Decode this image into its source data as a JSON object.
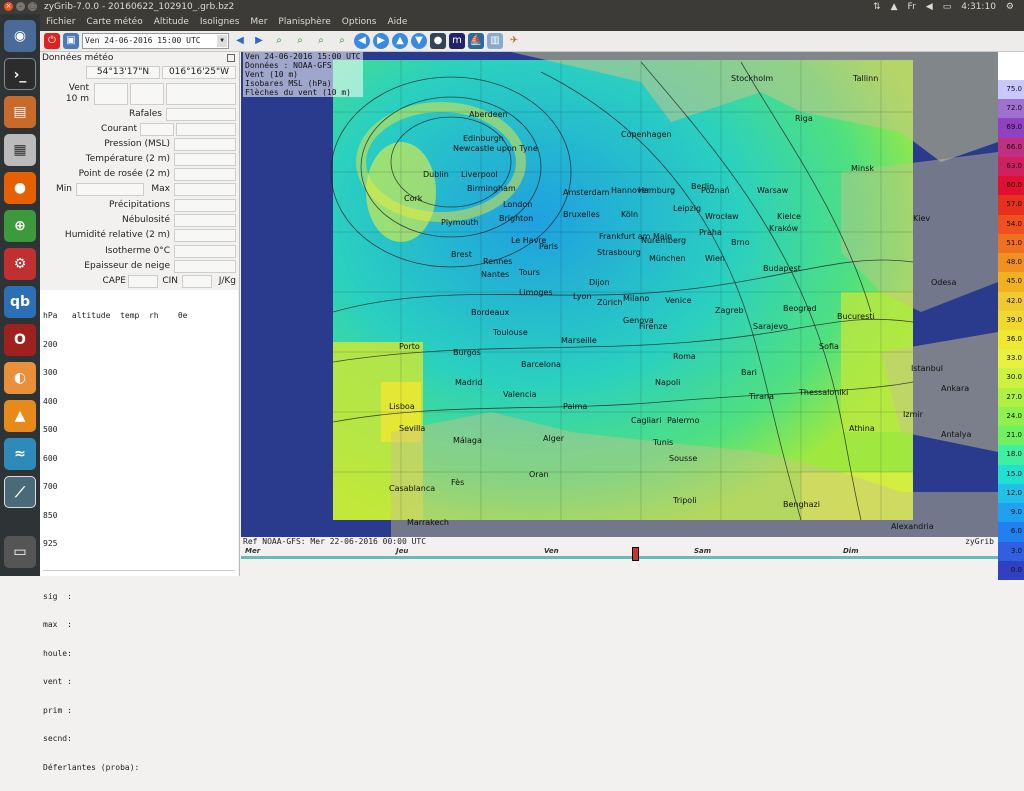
{
  "window": {
    "title": "zyGrib-7.0.0 - 20160622_102910_.grb.bz2"
  },
  "tray": {
    "indicator": "⇅",
    "wifi": "▲",
    "keyboard": "Fr",
    "volume": "◀",
    "battery": "▭",
    "clock": "4:31:10",
    "power": "⚙"
  },
  "menu": [
    "Fichier",
    "Carte météo",
    "Altitude",
    "Isolignes",
    "Mer",
    "Planisphère",
    "Options",
    "Aide"
  ],
  "toolbar": {
    "date_value": "Ven 24-06-2016 15:00 UTC"
  },
  "panel": {
    "title": "Données météo",
    "lat": "54°13'17\"N",
    "lon": "016°16'25\"W",
    "vent": "Vent",
    "vent_alt": "10 m",
    "rafales": "Rafales",
    "courant": "Courant",
    "pression": "Pression (MSL)",
    "temperature": "Température (2 m)",
    "rosee": "Point de rosée (2 m)",
    "min": "Min",
    "max": "Max",
    "precip": "Précipitations",
    "nebulosite": "Nébulosité",
    "humidite": "Humidité relative (2 m)",
    "isotherme": "Isotherme 0°C",
    "neige": "Epaisseur de neige",
    "cape": "CAPE",
    "cin": "CIN",
    "jkg": "J/Kg",
    "profile_lines": [
      "hPa   altitude  temp  rh    θe",
      "200",
      "300",
      "400",
      "500",
      "600",
      "700",
      "850",
      "925"
    ],
    "wave_lines": [
      "sig  :",
      "max  :",
      "houle:",
      "vent :",
      "prim :",
      "secnd:",
      "Déferlantes (proba):"
    ]
  },
  "map": {
    "header": [
      "Ven 24-06-2016 15:00 UTC",
      "Données : NOAA-GFS",
      "Vent (10 m)",
      "Isobares MSL (hPa)",
      "Flèches du vent (10 m)"
    ],
    "cities": [
      {
        "name": "Stockholm"
      },
      {
        "name": "Tallinn"
      },
      {
        "name": "Riga"
      },
      {
        "name": "Aberdeen"
      },
      {
        "name": "Edinburgh"
      },
      {
        "name": "Newcastle upon Tyne"
      },
      {
        "name": "Copenhagen"
      },
      {
        "name": "Dublin"
      },
      {
        "name": "Liverpool"
      },
      {
        "name": "Hamburg"
      },
      {
        "name": "Berlin"
      },
      {
        "name": "Birmingham"
      },
      {
        "name": "London"
      },
      {
        "name": "Amsterdam"
      },
      {
        "name": "Hannover"
      },
      {
        "name": "Poznań"
      },
      {
        "name": "Warsaw"
      },
      {
        "name": "Minsk"
      },
      {
        "name": "Cork"
      },
      {
        "name": "Plymouth"
      },
      {
        "name": "Brighton"
      },
      {
        "name": "Bruxelles"
      },
      {
        "name": "Köln"
      },
      {
        "name": "Leipzig"
      },
      {
        "name": "Wrocław"
      },
      {
        "name": "Kielce"
      },
      {
        "name": "Kiev"
      },
      {
        "name": "Le Havre"
      },
      {
        "name": "Paris"
      },
      {
        "name": "Frankfurt am Main"
      },
      {
        "name": "Praha"
      },
      {
        "name": "Kraków"
      },
      {
        "name": "Brest"
      },
      {
        "name": "Rennes"
      },
      {
        "name": "Strasbourg"
      },
      {
        "name": "Nuremberg"
      },
      {
        "name": "Brno"
      },
      {
        "name": "Nantes"
      },
      {
        "name": "Tours"
      },
      {
        "name": "München"
      },
      {
        "name": "Wien"
      },
      {
        "name": "Budapest"
      },
      {
        "name": "Dijon"
      },
      {
        "name": "Zürich"
      },
      {
        "name": "Lyon"
      },
      {
        "name": "Milano"
      },
      {
        "name": "Venice"
      },
      {
        "name": "Zagreb"
      },
      {
        "name": "Bucuresti"
      },
      {
        "name": "Odesa"
      },
      {
        "name": "Bordeaux"
      },
      {
        "name": "Limoges"
      },
      {
        "name": "Genova"
      },
      {
        "name": "Beograd"
      },
      {
        "name": "Toulouse"
      },
      {
        "name": "Marseille"
      },
      {
        "name": "Firenze"
      },
      {
        "name": "Sarajevo"
      },
      {
        "name": "Sofia"
      },
      {
        "name": "Porto"
      },
      {
        "name": "Burgos"
      },
      {
        "name": "Barcelona"
      },
      {
        "name": "Roma"
      },
      {
        "name": "Istanbul"
      },
      {
        "name": "Madrid"
      },
      {
        "name": "Valencia"
      },
      {
        "name": "Napoli"
      },
      {
        "name": "Bari"
      },
      {
        "name": "Tirana"
      },
      {
        "name": "Thessaloniki"
      },
      {
        "name": "Ankara"
      },
      {
        "name": "Lisboa"
      },
      {
        "name": "Palma"
      },
      {
        "name": "Cagliari"
      },
      {
        "name": "Izmir"
      },
      {
        "name": "Sevilla"
      },
      {
        "name": "Málaga"
      },
      {
        "name": "Alger"
      },
      {
        "name": "Palermo"
      },
      {
        "name": "Athina"
      },
      {
        "name": "Antalya"
      },
      {
        "name": "Tunis"
      },
      {
        "name": "Casablanca"
      },
      {
        "name": "Fès"
      },
      {
        "name": "Oran"
      },
      {
        "name": "Sousse"
      },
      {
        "name": "Tripoli"
      },
      {
        "name": "Marrakech"
      },
      {
        "name": "Benghazi"
      },
      {
        "name": "Alexandria"
      }
    ]
  },
  "legend": {
    "values": [
      "75.0",
      "72.0",
      "69.0",
      "66.0",
      "63.0",
      "60.0",
      "57.0",
      "54.0",
      "51.0",
      "48.0",
      "45.0",
      "42.0",
      "39.0",
      "36.0",
      "33.0",
      "30.0",
      "27.0",
      "24.0",
      "21.0",
      "18.0",
      "15.0",
      "12.0",
      "9.0",
      "6.0",
      "3.0",
      "0.0"
    ],
    "colors": [
      "#c8c8ff",
      "#a070d0",
      "#9040c0",
      "#c03080",
      "#d02060",
      "#e01030",
      "#e83020",
      "#f05020",
      "#f07020",
      "#f09020",
      "#f0b020",
      "#f0c830",
      "#f0d830",
      "#f0e830",
      "#e8f040",
      "#d0f040",
      "#b0f040",
      "#90f050",
      "#70f060",
      "#40f0a0",
      "#20e0d0",
      "#20c0e8",
      "#20a0f0",
      "#2080f0",
      "#3060e0",
      "#3040c0"
    ]
  },
  "refbar": {
    "text": "Ref NOAA-GFS: Mer 22-06-2016 00:00 UTC",
    "brand": "zyGrib"
  },
  "timeline": {
    "days": [
      "Mer",
      "Jeu",
      "Ven",
      "Sam",
      "Dim"
    ]
  }
}
